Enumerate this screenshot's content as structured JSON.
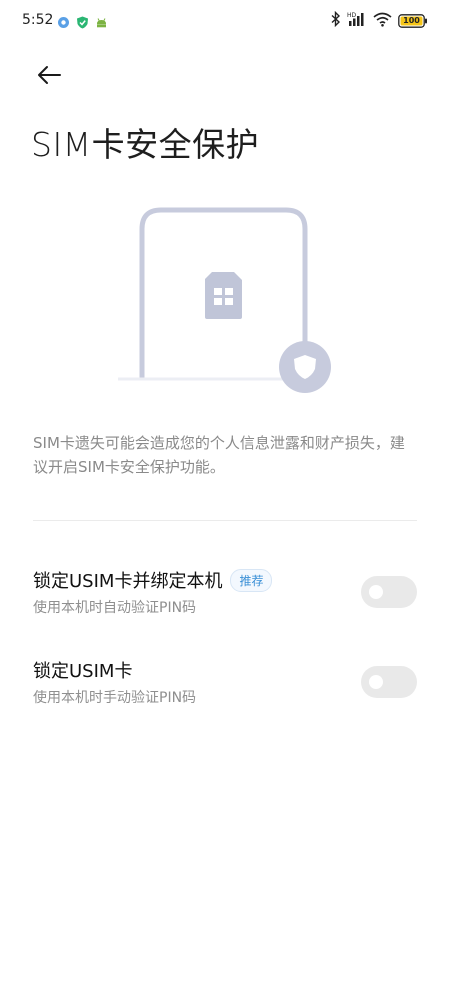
{
  "status_bar": {
    "time": "5:52",
    "battery": "100",
    "signal_tag": "HD",
    "icons": [
      "browser-icon",
      "shield-app-icon",
      "android-icon",
      "bluetooth-icon",
      "cellular-signal-icon",
      "wifi-icon",
      "battery-icon"
    ]
  },
  "header": {
    "back_icon": "arrow-left-icon",
    "title": "SIM卡安全保护"
  },
  "illustration": {
    "icons": [
      "phone-outline-icon",
      "sim-card-icon",
      "shield-icon"
    ]
  },
  "description": "SIM卡遗失可能会造成您的个人信息泄露和财产损失，建议开启SIM卡安全保护功能。",
  "settings": [
    {
      "title": "锁定USIM卡并绑定本机",
      "badge": "推荐",
      "subtitle": "使用本机时自动验证PIN码",
      "enabled": false
    },
    {
      "title": "锁定USIM卡",
      "subtitle": "使用本机时手动验证PIN码",
      "enabled": false
    }
  ],
  "colors": {
    "illustration": "#c7cbdd",
    "accent": "#3a8fd6",
    "toggle_off": "#e9e9e9"
  }
}
